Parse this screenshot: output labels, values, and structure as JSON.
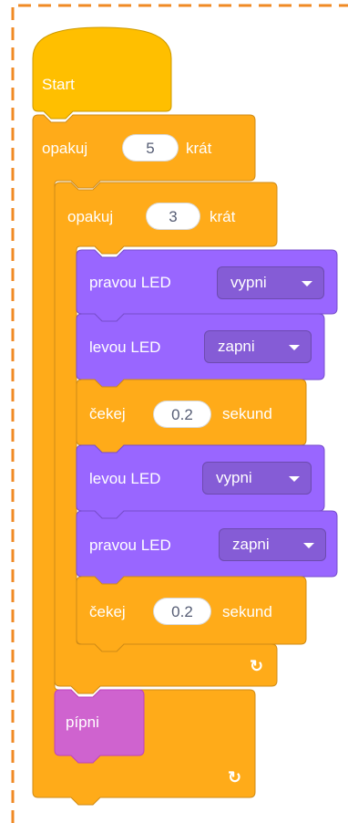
{
  "colors": {
    "events": "#ffbf00",
    "control": "#ffab19",
    "looks": "#9966ff",
    "sound": "#cf63cf",
    "dashed_frame": "#f08a24"
  },
  "blocks": {
    "start": {
      "label": "Start"
    },
    "outer_repeat": {
      "prefix": "opakuj",
      "times": "5",
      "suffix": "krát",
      "loop_icon": "repeat-arrow-icon"
    },
    "inner_repeat": {
      "prefix": "opakuj",
      "times": "3",
      "suffix": "krát",
      "loop_icon": "repeat-arrow-icon"
    },
    "led1": {
      "label": "pravou LED",
      "value": "vypni"
    },
    "led2": {
      "label": "levou LED",
      "value": "zapni"
    },
    "wait1": {
      "prefix": "čekej",
      "value": "0.2",
      "suffix": "sekund"
    },
    "led3": {
      "label": "levou LED",
      "value": "vypni"
    },
    "led4": {
      "label": "pravou LED",
      "value": "zapni"
    },
    "wait2": {
      "prefix": "čekej",
      "value": "0.2",
      "suffix": "sekund"
    },
    "beep": {
      "label": "pípni"
    }
  }
}
